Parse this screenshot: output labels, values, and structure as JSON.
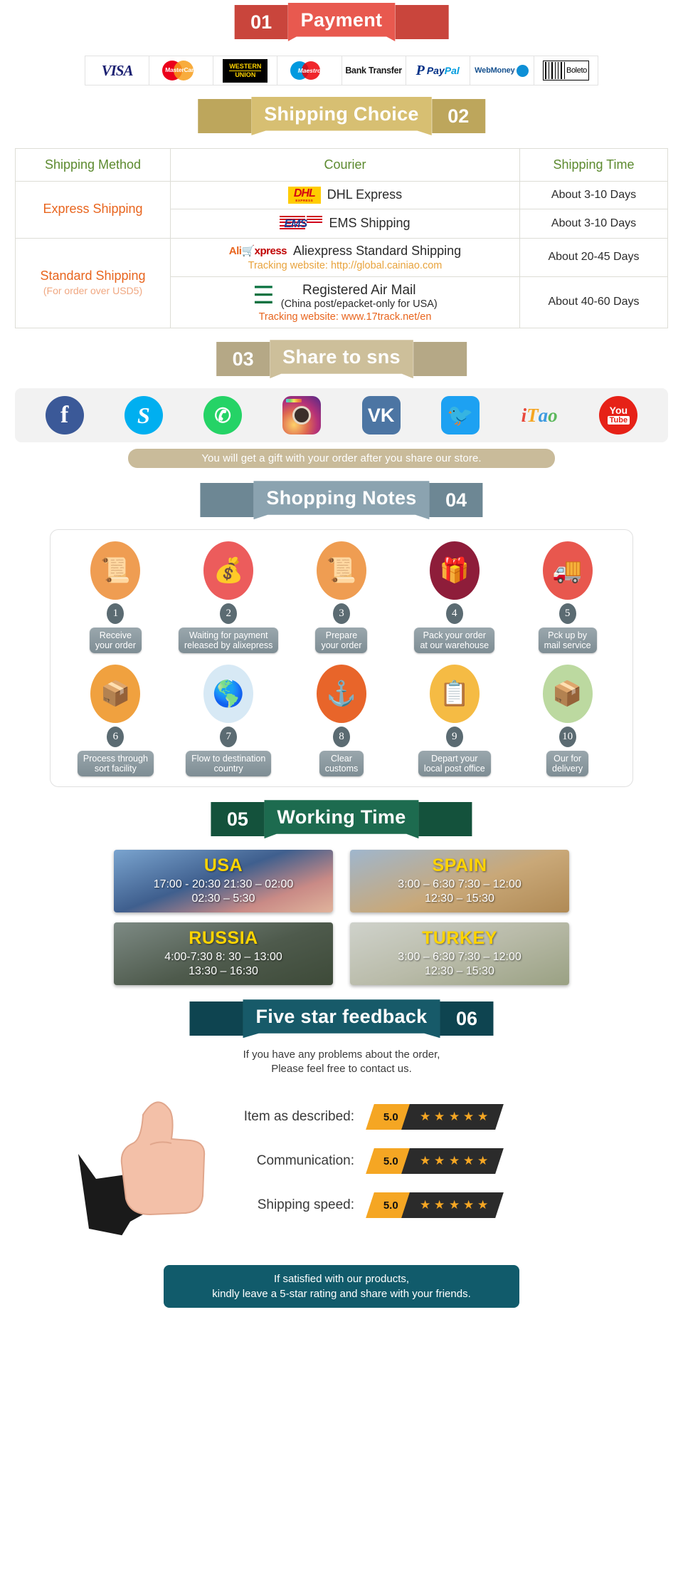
{
  "sections": [
    {
      "num": "01",
      "title": "Payment",
      "num_side": "left",
      "color": "#e8594f",
      "dark": "#c9453c"
    },
    {
      "num": "02",
      "title": "Shipping Choice",
      "num_side": "right",
      "color": "#d7bf72",
      "dark": "#bda65c"
    },
    {
      "num": "03",
      "title": "Share to sns",
      "num_side": "left",
      "color": "#cdbf9a",
      "dark": "#b5a886"
    },
    {
      "num": "04",
      "title": "Shopping Notes",
      "num_side": "right",
      "color": "#8ba3b0",
      "dark": "#6d8794"
    },
    {
      "num": "05",
      "title": "Working Time",
      "num_side": "left",
      "color": "#1d6b4f",
      "dark": "#14523c"
    },
    {
      "num": "06",
      "title": "Five star feedback",
      "num_side": "right",
      "color": "#175a69",
      "dark": "#0e4450"
    }
  ],
  "payment": {
    "methods": [
      {
        "name": "visa-logo",
        "label": "VISA"
      },
      {
        "name": "mastercard-logo",
        "label": "MasterCard"
      },
      {
        "name": "western-union-logo",
        "label_line1": "WESTERN",
        "label_line2": "UNION"
      },
      {
        "name": "maestro-logo",
        "label": "Maestro"
      },
      {
        "name": "bank-transfer-logo",
        "label": "Bank Transfer"
      },
      {
        "name": "paypal-logo",
        "label_p": "P",
        "label_pay": "Pay",
        "label_pal": "Pal"
      },
      {
        "name": "webmoney-logo",
        "label": "WebMoney"
      },
      {
        "name": "boleto-logo",
        "label": "Boleto"
      }
    ]
  },
  "shipping": {
    "headers": [
      "Shipping Method",
      "Courier",
      "Shipping Time"
    ],
    "groups": [
      {
        "method": "Express Shipping",
        "method_sub": "",
        "rows": [
          {
            "logo": "dhl-logo",
            "logo_text": "DHL",
            "logo_sub": "EXPRESS",
            "name": "DHL Express",
            "sub": "",
            "track": "",
            "time": "About 3-10 Days"
          },
          {
            "logo": "ems-logo",
            "logo_text": "EMS",
            "logo_sub": "",
            "name": "EMS Shipping",
            "sub": "",
            "track": "",
            "time": "About 3-10 Days"
          }
        ]
      },
      {
        "method": "Standard Shipping",
        "method_sub": "(For order over USD5)",
        "rows": [
          {
            "logo": "aliexpress-logo",
            "logo_text": "AliExpress",
            "logo_sub": "",
            "name": "Aliexpress Standard Shipping",
            "sub": "",
            "track": "Tracking website: http://global.cainiao.com",
            "time": "About 20-45 Days"
          },
          {
            "logo": "china-post-logo",
            "logo_text": "China Post",
            "logo_sub": "",
            "name": "Registered Air Mail",
            "sub": "(China post/epacket-only for USA)",
            "track": "Tracking website: www.17track.net/en",
            "time": "About 40-60 Days"
          }
        ]
      }
    ]
  },
  "sns": {
    "icons": [
      {
        "name": "facebook-icon",
        "glyph": "f"
      },
      {
        "name": "skype-icon",
        "glyph": "S"
      },
      {
        "name": "whatsapp-icon",
        "glyph": "✆"
      },
      {
        "name": "instagram-icon",
        "glyph": ""
      },
      {
        "name": "vk-icon",
        "glyph": "VK"
      },
      {
        "name": "twitter-icon",
        "glyph": "ᵛ"
      },
      {
        "name": "itao-icon",
        "glyph": "iTao"
      },
      {
        "name": "youtube-icon",
        "glyph_top": "You",
        "glyph_bottom": "Tube"
      }
    ],
    "gift_note": "You will get a gift with your order after you share our store."
  },
  "notes": {
    "steps": [
      {
        "num": "1",
        "label": "Receive\nyour order",
        "icon": "document-hand-icon",
        "bg": "#ef9d52"
      },
      {
        "num": "2",
        "label": "Waiting for payment\nreleased by alixepress",
        "icon": "money-bag-icon",
        "bg": "#ec5c5c"
      },
      {
        "num": "3",
        "label": "Prepare\nyour order",
        "icon": "document-hand-icon",
        "bg": "#ef9d52"
      },
      {
        "num": "4",
        "label": "Pack your order\nat our warehouse",
        "icon": "gift-box-icon",
        "bg": "#8e1d3a"
      },
      {
        "num": "5",
        "label": "Pck up by\nmail service",
        "icon": "mail-truck-icon",
        "bg": "#e8574e"
      },
      {
        "num": "6",
        "label": "Process through\nsort facility",
        "icon": "hand-truck-icon",
        "bg": "#f0a13f"
      },
      {
        "num": "7",
        "label": "Flow to destination\ncountry",
        "icon": "globe-icon",
        "bg": "#d7e9f5"
      },
      {
        "num": "8",
        "label": "Clear\ncustoms",
        "icon": "anchor-icon",
        "bg": "#e8652a"
      },
      {
        "num": "9",
        "label": "Depart your\nlocal post office",
        "icon": "postman-icon",
        "bg": "#f5bb44"
      },
      {
        "num": "10",
        "label": "Our for\ndelivery",
        "icon": "parcel-icon",
        "bg": "#bcd9a0"
      }
    ]
  },
  "working_time": {
    "cards": [
      {
        "country": "USA",
        "times": "17:00 - 20:30  21:30 – 02:00\n02:30 – 5:30",
        "theme": "tc-usa"
      },
      {
        "country": "SPAIN",
        "times": "3:00 – 6:30   7:30 – 12:00\n12:30 – 15:30",
        "theme": "tc-spain"
      },
      {
        "country": "RUSSIA",
        "times": "4:00-7:30   8: 30 – 13:00\n13:30 – 16:30",
        "theme": "tc-russia"
      },
      {
        "country": "TURKEY",
        "times": "3:00 – 6:30   7:30 – 12:00\n12:30 – 15:30",
        "theme": "tc-turkey"
      }
    ]
  },
  "feedback": {
    "intro": "If you have any problems about the order,\nPlease feel free to contact us.",
    "ratings": [
      {
        "label": "Item as described:",
        "score": "5.0",
        "stars": 5
      },
      {
        "label": "Communication:",
        "score": "5.0",
        "stars": 5
      },
      {
        "label": "Shipping speed:",
        "score": "5.0",
        "stars": 5
      }
    ],
    "footer": "If satisfied with our products,\nkindly leave a 5-star rating and share with your friends."
  }
}
